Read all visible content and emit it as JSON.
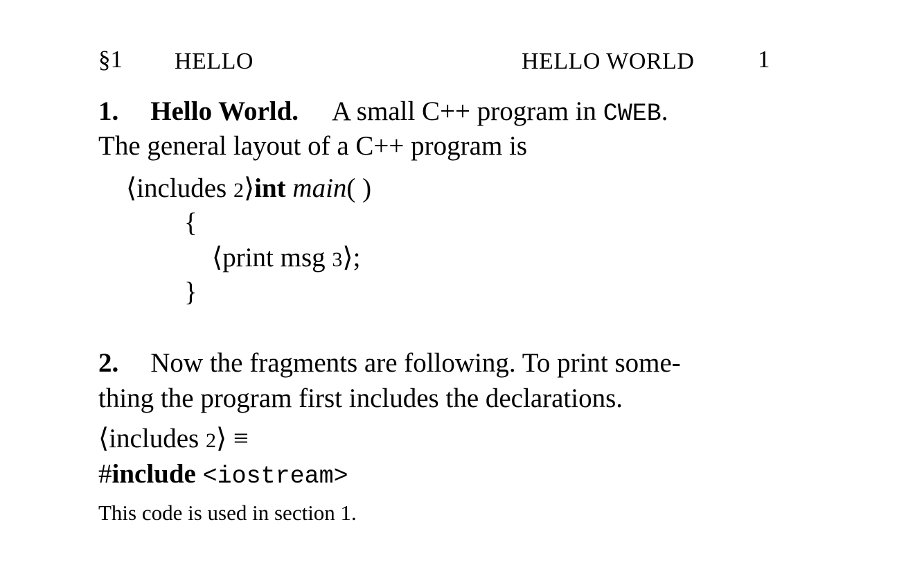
{
  "header": {
    "section_mark": "§1",
    "left_title": "HELLO",
    "right_title": "HELLO WORLD",
    "page_number": "1"
  },
  "section1": {
    "number": "1.",
    "title": "Hello World.",
    "intro_text": "A small C++ program in",
    "cweb": "CWEB",
    "intro_period": ".",
    "line2": "The general layout of a C++ program is",
    "code": {
      "langle": "⟨",
      "includes_name": "includes",
      "includes_ref": "2",
      "rangle": "⟩",
      "int_kw": "int",
      "main_fn": "main",
      "parens": "( )",
      "open_brace": "{",
      "print_langle": "⟨",
      "print_name": "print msg",
      "print_ref": "3",
      "print_rangle": "⟩",
      "semicolon": ";",
      "close_brace": "}"
    }
  },
  "section2": {
    "number": "2.",
    "line1": "Now the fragments are following. To print some-",
    "line2": "thing the program first includes the declarations.",
    "def": {
      "langle": "⟨",
      "name": "includes",
      "ref": "2",
      "rangle": "⟩",
      "equiv": "≡"
    },
    "include_hash": "#",
    "include_kw": "include",
    "include_file": "<iostream>",
    "used_in": "This code is used in section 1."
  }
}
